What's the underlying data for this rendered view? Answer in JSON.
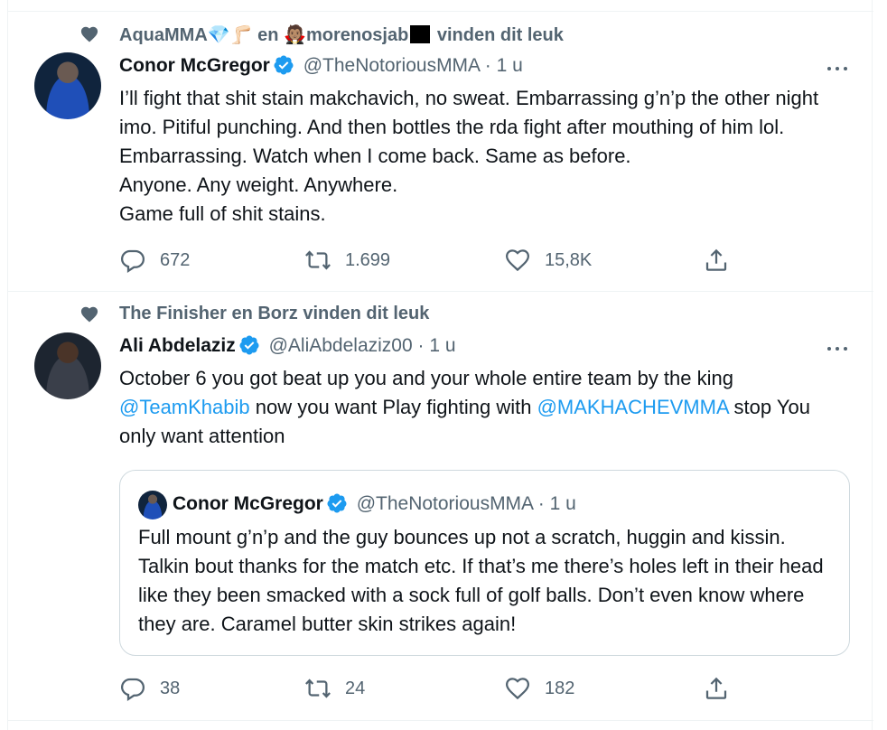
{
  "colors": {
    "accent": "#1d9bf0",
    "secondary_text": "#536471",
    "text": "#0f1419",
    "border": "#eff3f4"
  },
  "tweets": [
    {
      "social_context": {
        "user1": "AquaMMA",
        "user1_emoji": "💎🦵🏻",
        "conjunction": "en",
        "user2_emoji": "🧛🏽",
        "user2": "morenosjab",
        "suffix": "vinden dit leuk"
      },
      "author": {
        "name": "Conor McGregor",
        "handle": "@TheNotoriousMMA",
        "dot": "·",
        "time": "1 u"
      },
      "text": "I’ll fight that shit stain makchavich, no sweat. Embarrassing g’n’p the other night imo. Pitiful punching. And then bottles the rda fight after mouthing of him lol. Embarrassing. Watch when I come back. Same as before.\nAnyone. Any weight. Anywhere.\nGame full of shit stains.",
      "stats": {
        "replies": "672",
        "retweets": "1.699",
        "likes": "15,8K"
      }
    },
    {
      "social_context": {
        "text": "The Finisher en Borz vinden dit leuk"
      },
      "author": {
        "name": "Ali Abdelaziz",
        "handle": "@AliAbdelaziz00",
        "dot": "·",
        "time": "1 u"
      },
      "text_parts": {
        "p1": "October 6 you got beat up you and your whole entire team by the king ",
        "mention1": "@TeamKhabib",
        "p2": " now you want Play fighting with ",
        "mention2": "@MAKHACHEVMMA",
        "p3": " stop You only want attention"
      },
      "quote": {
        "name": "Conor McGregor",
        "handle": "@TheNotoriousMMA",
        "dot": "·",
        "time": "1 u",
        "text": "Full mount g’n’p and the guy bounces up not a scratch, huggin and kissin. Talkin bout thanks for the match etc. If that’s me there’s holes left in their head like they been smacked with a sock full of golf balls. Don’t even know where they are. Caramel butter skin strikes again!"
      },
      "stats": {
        "replies": "38",
        "retweets": "24",
        "likes": "182"
      }
    }
  ]
}
